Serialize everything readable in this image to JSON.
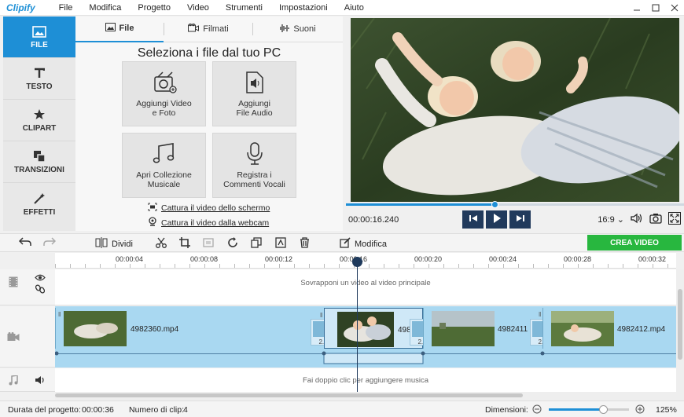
{
  "menubar": {
    "app_name": "Clipify",
    "items": [
      "File",
      "Modifica",
      "Progetto",
      "Video",
      "Strumenti",
      "Impostazioni",
      "Aiuto"
    ]
  },
  "left_tabs": [
    {
      "label": "FILE",
      "icon": "image-icon",
      "active": true
    },
    {
      "label": "TESTO",
      "icon": "text-icon"
    },
    {
      "label": "CLIPART",
      "icon": "star-icon"
    },
    {
      "label": "TRANSIZIONI",
      "icon": "transitions-icon"
    },
    {
      "label": "EFFETTI",
      "icon": "magic-wand-icon"
    }
  ],
  "subtabs": [
    {
      "label": "File",
      "icon": "image-icon",
      "active": true
    },
    {
      "label": "Filmati",
      "icon": "film-icon"
    },
    {
      "label": "Suoni",
      "icon": "waveform-icon"
    }
  ],
  "panel": {
    "title": "Seleziona i file dal tuo PC",
    "tiles": [
      {
        "line1": "Aggiungi Video",
        "line2": "e Foto",
        "icon": "media-icon"
      },
      {
        "line1": "Aggiungi",
        "line2": "File Audio",
        "icon": "audio-file-icon"
      },
      {
        "line1": "Apri Collezione",
        "line2": "Musicale",
        "icon": "music-notes-icon"
      },
      {
        "line1": "Registra i",
        "line2": "Commenti Vocali",
        "icon": "microphone-icon"
      }
    ],
    "links": [
      "Cattura il video dello schermo",
      "Cattura il video dalla webcam"
    ]
  },
  "preview": {
    "timecode": "00:00:16.240",
    "aspect": "16:9",
    "progress": 0.44
  },
  "toolbar": {
    "split_label": "Dividi",
    "edit_label": "Modifica",
    "create_label": "CREA VIDEO"
  },
  "timeline": {
    "ruler": [
      "00:00:04",
      "00:00:08",
      "00:00:12",
      "00:00:16",
      "00:00:20",
      "00:00:24",
      "00:00:28",
      "00:00:32"
    ],
    "overlay_hint": "Sovrapponi un video al video principale",
    "music_hint": "Fai doppio clic per aggiungere musica",
    "clips": [
      "4982360.mp4",
      "498",
      "4982411",
      "4982412.mp4"
    ],
    "transition_duration": "2.0"
  },
  "status": {
    "duration_label": "Durata del progetto:",
    "duration_value": "00:00:36",
    "clips_label": "Numero di clip:",
    "clips_value": "4",
    "dims_label": "Dimensioni:",
    "zoom": "125%"
  },
  "colors": {
    "accent": "#1e8fd6",
    "create": "#28b73f",
    "transport": "#213a5c"
  }
}
